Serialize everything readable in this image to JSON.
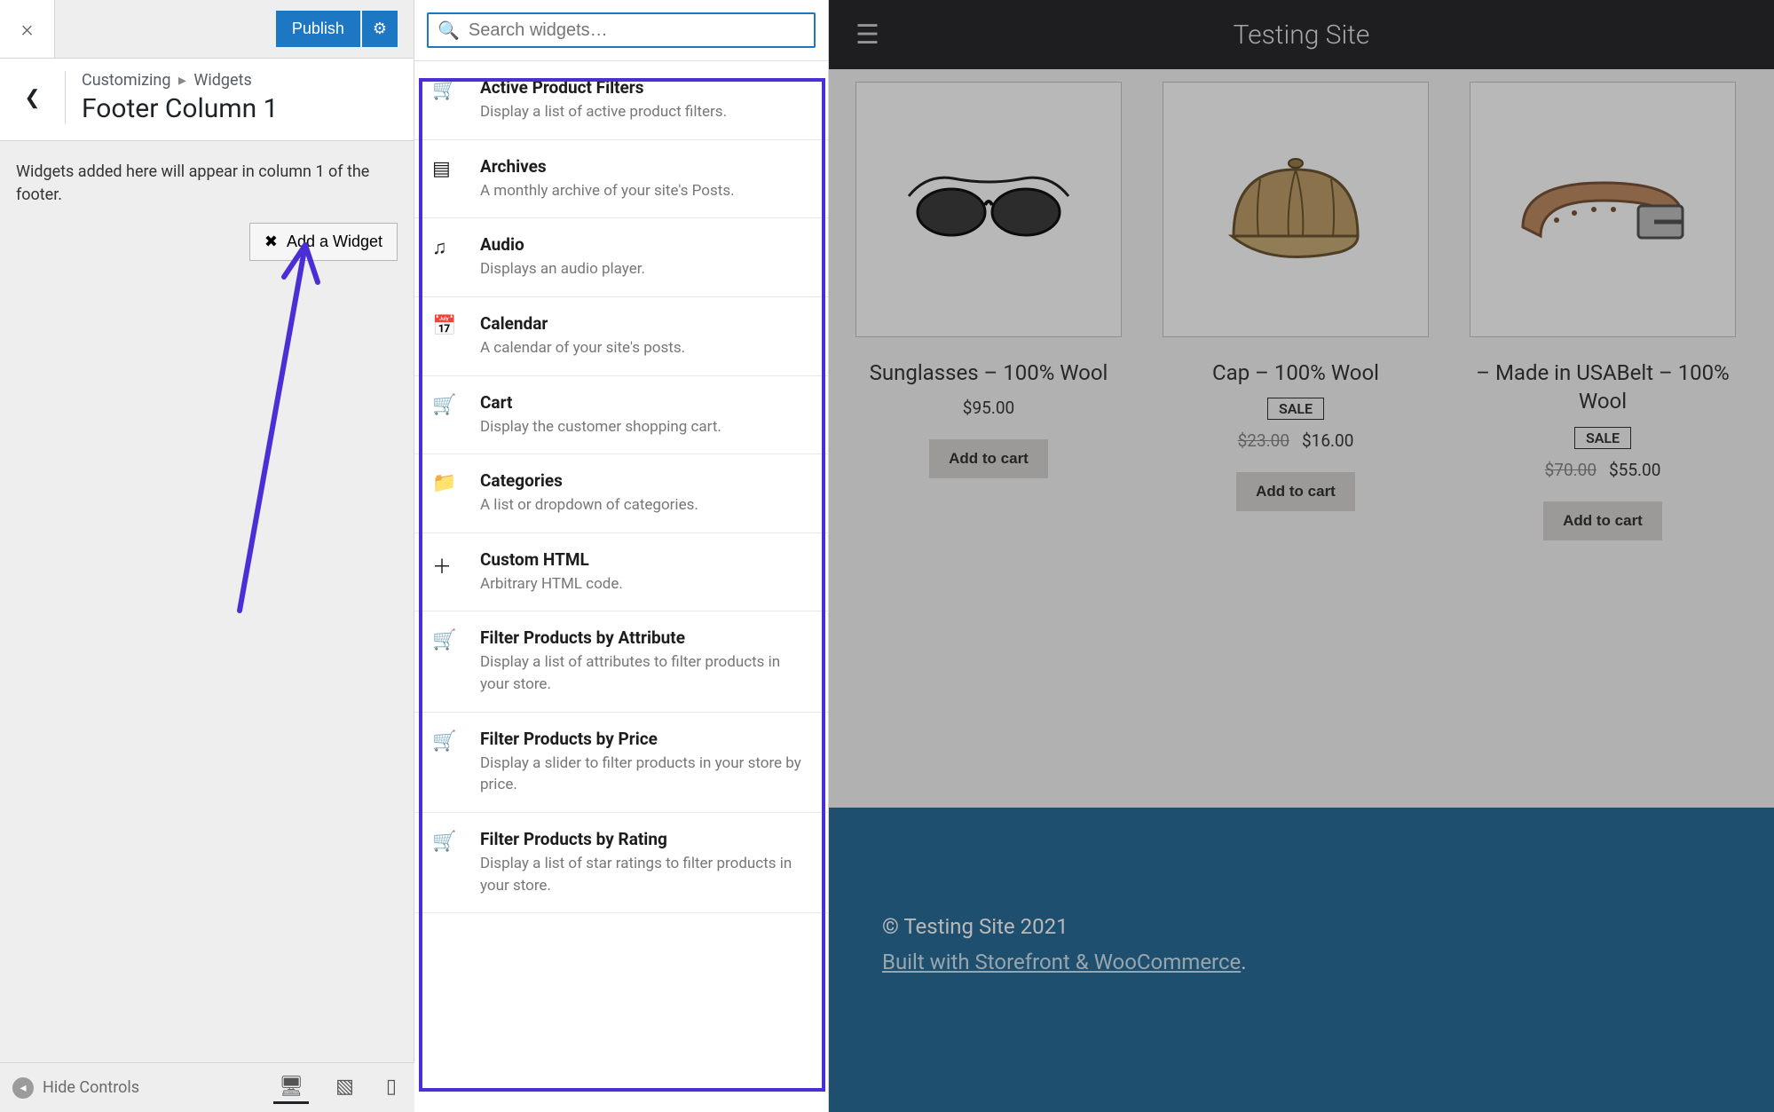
{
  "colors": {
    "accent": "#1e77c3",
    "annot": "#4b2ed6"
  },
  "top": {
    "publish": "Publish"
  },
  "breadcrumb": {
    "root": "Customizing",
    "section": "Widgets"
  },
  "panel": {
    "title": "Footer Column 1",
    "desc": "Widgets added here will appear in column 1 of the footer.",
    "add_widget": "Add a Widget"
  },
  "search": {
    "placeholder": "Search widgets…"
  },
  "widgets": [
    {
      "icon": "cart-icon",
      "title": "Active Product Filters",
      "desc": "Display a list of active product filters."
    },
    {
      "icon": "archive-icon",
      "title": "Archives",
      "desc": "A monthly archive of your site's Posts."
    },
    {
      "icon": "music-icon",
      "title": "Audio",
      "desc": "Displays an audio player."
    },
    {
      "icon": "calendar-icon",
      "title": "Calendar",
      "desc": "A calendar of your site's posts."
    },
    {
      "icon": "cart-icon",
      "title": "Cart",
      "desc": "Display the customer shopping cart."
    },
    {
      "icon": "folder-icon",
      "title": "Categories",
      "desc": "A list or dropdown of categories."
    },
    {
      "icon": "plus-icon",
      "title": "Custom HTML",
      "desc": "Arbitrary HTML code."
    },
    {
      "icon": "cart-icon",
      "title": "Filter Products by Attribute",
      "desc": "Display a list of attributes to filter products in your store."
    },
    {
      "icon": "cart-icon",
      "title": "Filter Products by Price",
      "desc": "Display a slider to filter products in your store by price."
    },
    {
      "icon": "cart-icon",
      "title": "Filter Products by Rating",
      "desc": "Display a list of star ratings to filter products in your store."
    }
  ],
  "devicebar": {
    "hide": "Hide Controls"
  },
  "preview": {
    "sitename": "Testing Site",
    "products": [
      {
        "title": "Sunglasses – 100% Wool",
        "price": "$95.00",
        "cta": "Add to cart",
        "sale": false
      },
      {
        "title": "Cap – 100% Wool",
        "old_price": "$23.00",
        "price": "$16.00",
        "cta": "Add to cart",
        "sale": true,
        "sale_label": "SALE"
      },
      {
        "title": "– Made in USABelt – 100% Wool",
        "old_price": "$70.00",
        "price": "$55.00",
        "cta": "Add to cart",
        "sale": true,
        "sale_label": "SALE"
      }
    ],
    "footer": {
      "copyright": "© Testing Site 2021",
      "credit": "Built with Storefront & WooCommerce",
      "suffix": "."
    }
  }
}
